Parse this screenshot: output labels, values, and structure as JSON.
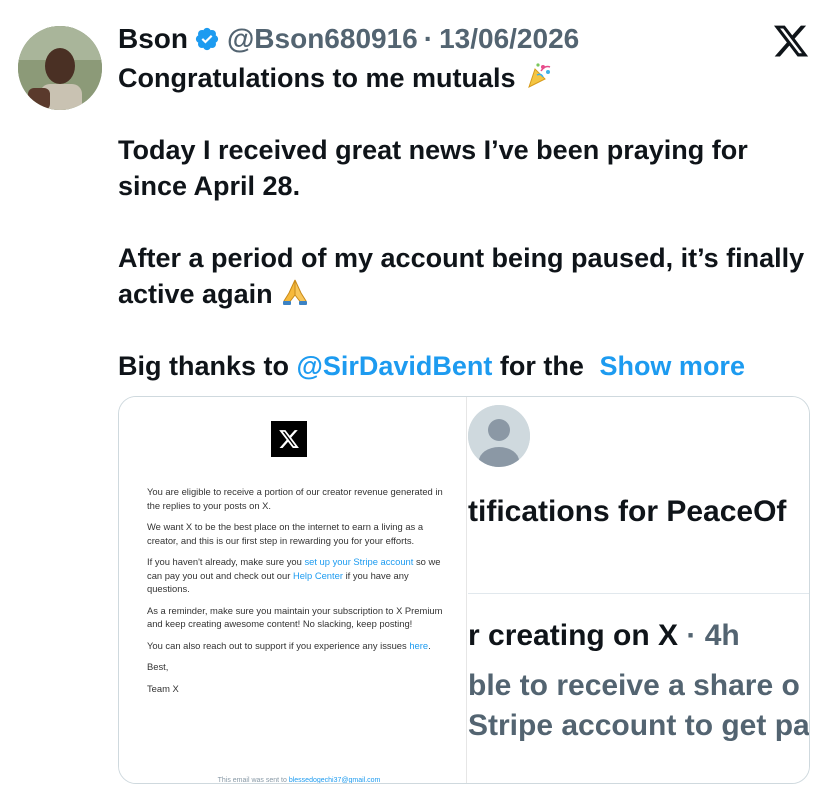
{
  "tweet": {
    "display_name": "Bson",
    "handle": "@Bson680916",
    "separator": "·",
    "date": "13/06/2026",
    "body": {
      "line1": "Congratulations to me  mutuals",
      "line2": "Today I received great news I’ve been praying for since April 28.",
      "line3": "After a period of my account being paused, it’s finally active again",
      "line4_prefix": "Big thanks to",
      "mention": "@SirDavidBent",
      "line4_suffix": "for the",
      "show_more": "Show more"
    }
  },
  "email": {
    "p1": "You are eligible to receive a portion of our creator revenue generated in the replies to your posts on X.",
    "p2": "We want X to be the best place on the internet to earn a living as a creator, and this is our first step in rewarding you for your efforts.",
    "p3_a": "If you haven't already, make sure you",
    "p3_link1": "set up your Stripe account",
    "p3_b": "so we can pay you out and check out our",
    "p3_link2": "Help Center",
    "p3_c": "if you have any questions.",
    "p4": "As a reminder, make sure you maintain your subscription to X Premium and keep creating awesome content! No slacking, keep posting!",
    "p5": "You can also reach out to support if you experience any issues",
    "p5_link": "here",
    "p5_end": ".",
    "sign1": "Best,",
    "sign2": "Team X",
    "footer_text": "This email was sent to",
    "footer_email": "blessedogechi37@gmail.com"
  },
  "notification": {
    "title": "tifications for PeaceOf",
    "sub": "r creating on X",
    "sub_sep": " · ",
    "sub_time": "4h",
    "line1": "ble to receive a share o",
    "line2": "Stripe account to get pa"
  },
  "colors": {
    "accent": "#1d9bf0",
    "text": "#0f1419",
    "muted": "#536471"
  },
  "icons": {
    "verified": "verified-badge-icon",
    "x_logo": "x-logo-icon",
    "party": "party-popper-emoji",
    "pray": "praying-hands-emoji"
  }
}
